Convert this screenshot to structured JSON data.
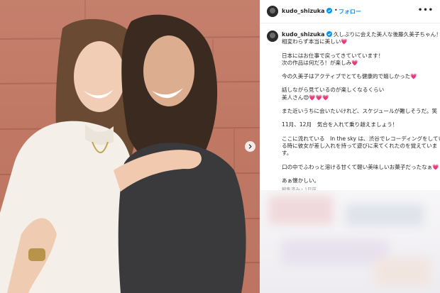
{
  "post": {
    "username": "kudo_shizuka",
    "follow_label": "フォロー",
    "separator": "•",
    "more_label": "•••"
  },
  "caption": {
    "username": "kudo_shizuka",
    "lines": [
      "久しぶりに会えた美人な後藤久美子ちゃん！",
      "相変わらず本当に美しい💗",
      "",
      "日本にはお仕事で戻ってきていています！",
      "次の作品は何だろ！が楽しみ💗",
      "",
      "今の久美子はアクティブでとても健康的で嬉しかった💗",
      "",
      "話しながら見ているのが楽しくなるくらい",
      "美人さん😍💗💗💗",
      "",
      "また近いうちに会いたいけれど、スケジュールが難しそうだ。笑",
      "",
      "11月、12月　気合を入れて乗り越えましょう！",
      "",
      "ここに流れている　In the sky は、渋谷でレコーディングをしてい",
      "る時に彼女が差し入れを持って遊びに来てくれたのを覚えていま",
      "す。",
      "",
      "口の中でふわっと溶ける甘くて軽い美味しいお菓子だったなぁ💗",
      "",
      "あぁ懐かしい。"
    ],
    "meta": "編集済み・1日前"
  },
  "icons": {
    "verified": "verified-badge-icon",
    "next": "chevron-right-icon"
  },
  "colors": {
    "accent": "#0095f6",
    "wood": "#c47a66"
  }
}
